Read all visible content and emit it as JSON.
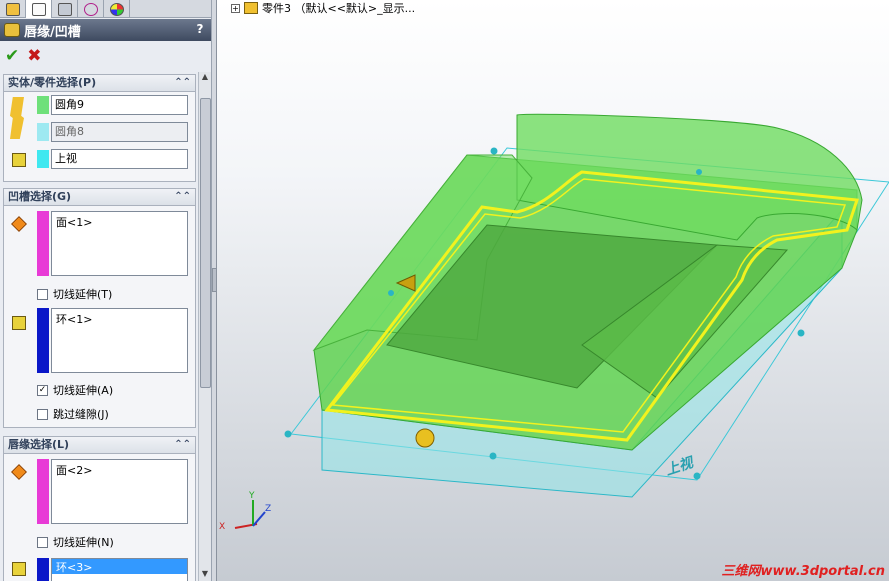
{
  "panel": {
    "title": "唇缘/凹槽",
    "help": "?",
    "ok_glyph": "✔",
    "cancel_glyph": "✖",
    "tabs": [
      "feature-manager-icon",
      "property-manager-icon",
      "configuration-manager-icon",
      "dimxpert-icon",
      "appearance-icon"
    ],
    "body_group": {
      "header": "实体/零件选择(P)",
      "collapse_glyph": "⌃⌃",
      "fields": [
        {
          "value": "圆角9",
          "dim": false,
          "swatch": "#6ee07a"
        },
        {
          "value": "圆角8",
          "dim": true,
          "swatch": "#9ee9f1"
        },
        {
          "value": "上视",
          "dim": false,
          "swatch": "#3fe8f0"
        }
      ]
    },
    "groove_group": {
      "header": "凹槽选择(G)",
      "collapse_glyph": "⌃⌃",
      "face_list": "面<1>",
      "face_swatch": "#e83ad6",
      "tangent_check": {
        "label": "切线延伸(T)",
        "checked": false
      },
      "loop_list": "环<1>",
      "loop_swatch": "#0a17c8",
      "tangent_check2": {
        "label": "切线延伸(A)",
        "checked": true
      },
      "skip_check": {
        "label": "跳过缝隙(J)",
        "checked": false
      }
    },
    "lip_group": {
      "header": "唇缘选择(L)",
      "collapse_glyph": "⌃⌃",
      "face_list": "面<2>",
      "face_swatch": "#e83ad6",
      "tangent_check": {
        "label": "切线延伸(N)",
        "checked": false
      },
      "loop_list": "环<3>",
      "loop_swatch": "#0a17c8"
    }
  },
  "viewport": {
    "tree_label": "零件3 （默认<<默认>_显示...",
    "plane_label": "上视",
    "triad": {
      "x": "X",
      "y": "Y",
      "z": "Z"
    },
    "watermark": "三维网www.3dportal.cn",
    "colors": {
      "body_green": "#62d452",
      "lip_yellow": "#f2f21e",
      "plane_cyan": "#3cc8d8"
    }
  }
}
